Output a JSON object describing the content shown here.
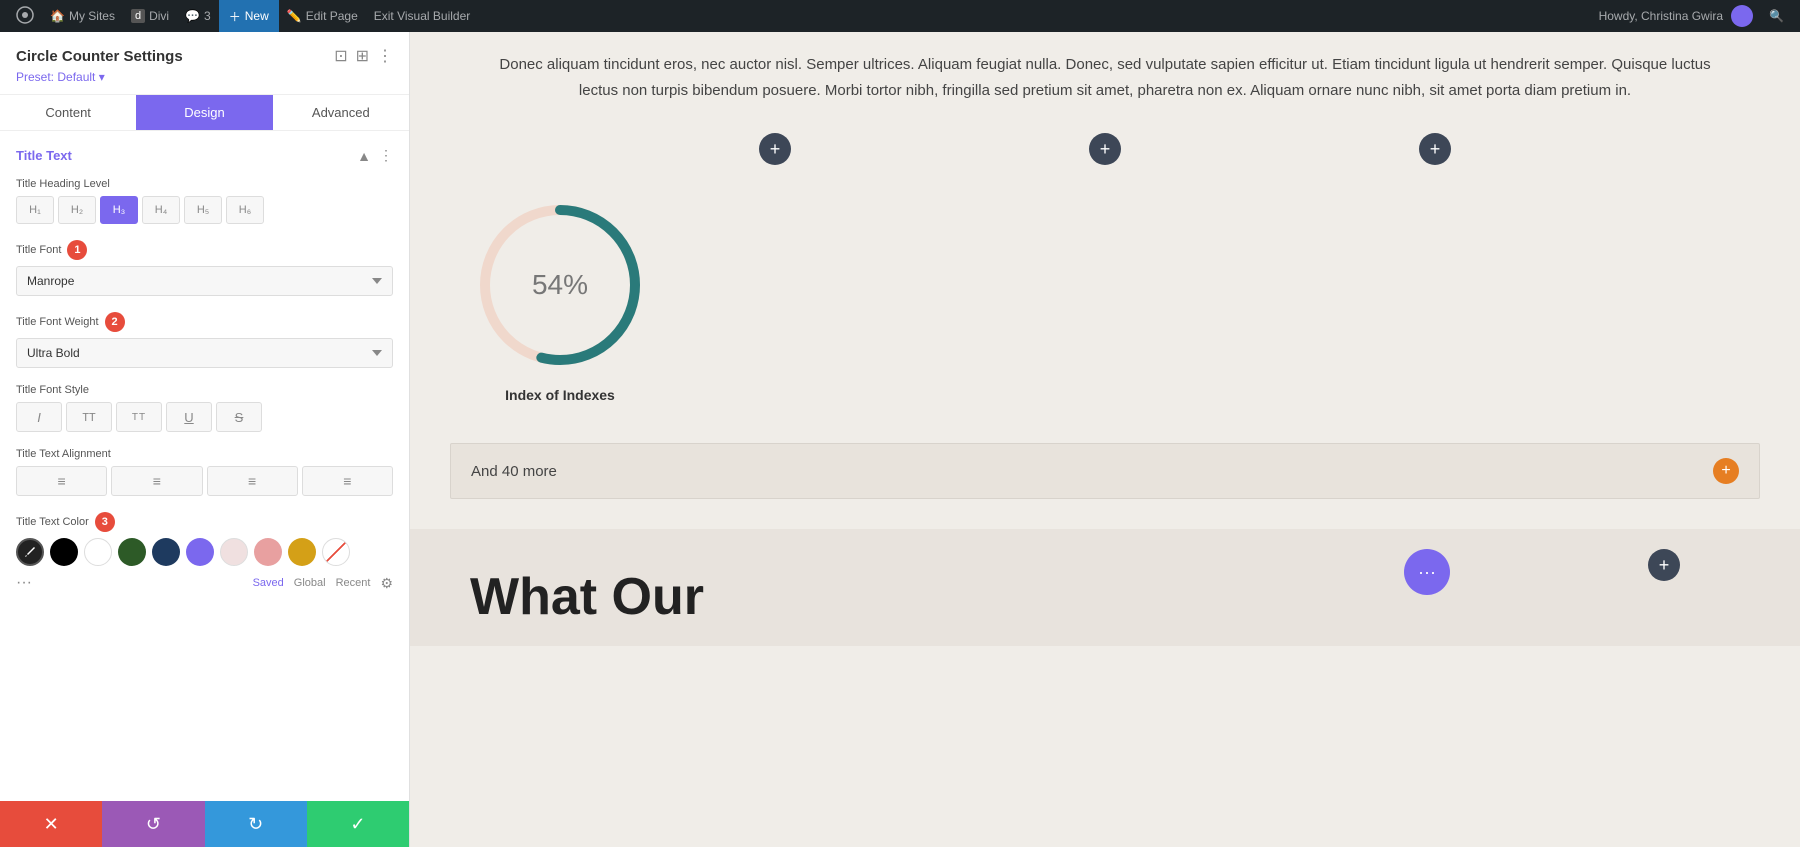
{
  "admin_bar": {
    "wp_icon": "⊞",
    "my_sites": "My Sites",
    "divi": "Divi",
    "comments_count": "3",
    "comments_icon": "💬",
    "new_label": "New",
    "edit_page": "Edit Page",
    "exit_builder": "Exit Visual Builder",
    "howdy": "Howdy, Christina Gwira"
  },
  "panel": {
    "title": "Circle Counter Settings",
    "preset_label": "Preset: Default",
    "tabs": [
      "Content",
      "Design",
      "Advanced"
    ],
    "active_tab": "Design"
  },
  "title_text_section": {
    "section_title": "Title Text",
    "heading_level_label": "Title Heading Level",
    "heading_buttons": [
      "H1",
      "H2",
      "H3",
      "H4",
      "H5",
      "H6"
    ],
    "active_heading": "H3",
    "font_label": "Title Font",
    "step1_badge": "1",
    "font_value": "Manrope",
    "font_weight_label": "Title Font Weight",
    "step2_badge": "2",
    "font_weight_value": "Ultra Bold",
    "font_style_label": "Title Font Style",
    "style_buttons": [
      "I",
      "TT",
      "Tt",
      "U",
      "S"
    ],
    "text_alignment_label": "Title Text Alignment",
    "text_color_label": "Title Text Color",
    "step3_badge": "3",
    "colors": [
      {
        "id": "eyedropper",
        "bg": "#222222",
        "label": "eyedropper"
      },
      {
        "id": "black",
        "bg": "#000000",
        "label": "black"
      },
      {
        "id": "white",
        "bg": "#ffffff",
        "label": "white"
      },
      {
        "id": "dark-green",
        "bg": "#2d5a27",
        "label": "dark green"
      },
      {
        "id": "navy",
        "bg": "#1e3a5f",
        "label": "navy"
      },
      {
        "id": "purple",
        "bg": "#7b68ee",
        "label": "purple"
      },
      {
        "id": "light-pink",
        "bg": "#f0e0e0",
        "label": "light pink"
      },
      {
        "id": "pink",
        "bg": "#e8a0a0",
        "label": "pink"
      },
      {
        "id": "gold",
        "bg": "#d4a017",
        "label": "gold"
      },
      {
        "id": "red-stroke",
        "bg": "#e74c3c",
        "label": "red stroke",
        "style": "stroke"
      }
    ],
    "color_footer": {
      "saved": "Saved",
      "global": "Global",
      "recent": "Recent"
    }
  },
  "footer": {
    "cancel_icon": "✕",
    "undo_icon": "↺",
    "redo_icon": "↻",
    "confirm_icon": "✓"
  },
  "content": {
    "body_text": "Donec aliquam tincidunt eros, nec auctor nisl. Semper ultrices. Aliquam feugiat nulla. Donec, sed vulputate sapien efficitur ut. Etiam tincidunt ligula ut hendrerit semper. Quisque luctus lectus non turpis bibendum posuere. Morbi tortor nibh, fringilla sed pretium sit amet, pharetra non ex. Aliquam ornare nunc nibh, sit amet porta diam pretium in.",
    "counter_value": "54%",
    "counter_label": "Index of Indexes",
    "and_more_text": "And 40 more",
    "what_our_title": "What Our"
  }
}
